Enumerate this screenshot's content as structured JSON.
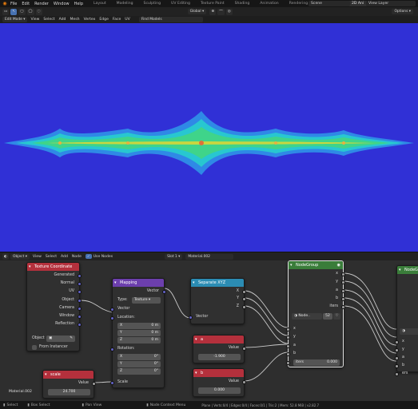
{
  "topbar": {
    "menu": [
      "File",
      "Edit",
      "Render",
      "Window",
      "Help"
    ],
    "workspaces": [
      "Layout",
      "Modeling",
      "Sculpting",
      "UV Editing",
      "Texture Paint",
      "Shading",
      "Animation",
      "Rendering",
      "Compositing",
      "2D Ani"
    ],
    "active_workspace": "2D Ani",
    "scene": "Scene",
    "view_layer": "View Layer"
  },
  "header": {
    "mode": "Edit Mode",
    "menu": [
      "View",
      "Select",
      "Add",
      "Mesh",
      "Vertex",
      "Edge",
      "Face",
      "UV"
    ],
    "transform": "Global",
    "options": "Options",
    "find": "Find Models"
  },
  "node_editor": {
    "type": "Object",
    "menu": [
      "View",
      "Select",
      "Add",
      "Node"
    ],
    "use_nodes_label": "Use Nodes",
    "slot": "Slot 1",
    "material": "Material.002",
    "material_name_bottom": "Material.002"
  },
  "nodes": {
    "texcoord": {
      "title": "Texture Coordinate",
      "outputs": [
        "Generated",
        "Normal",
        "UV",
        "Object",
        "Camera",
        "Window",
        "Reflection"
      ],
      "object_label": "Object",
      "from_instancer": "From Instancer",
      "color": "#b4303c"
    },
    "mapping": {
      "title": "Mapping",
      "output": "Vector",
      "type_label": "Type:",
      "type_value": "Texture",
      "vector_in": "Vector",
      "location_label": "Location:",
      "location": [
        {
          "axis": "X",
          "value": "0 m"
        },
        {
          "axis": "Y",
          "value": "0 m"
        },
        {
          "axis": "Z",
          "value": "0 m"
        }
      ],
      "rotation_label": "Rotation:",
      "rotation": [
        {
          "axis": "X",
          "value": "0°"
        },
        {
          "axis": "Y",
          "value": "0°"
        },
        {
          "axis": "Z",
          "value": "0°"
        }
      ],
      "scale_label": "Scale",
      "color": "#6c3fad"
    },
    "separate": {
      "title": "Separate XYZ",
      "outputs": [
        "X",
        "Y",
        "Z"
      ],
      "input": "Vector",
      "color": "#2b8cb3"
    },
    "a": {
      "title": "a",
      "output": "Value",
      "value": "-1.900",
      "color": "#b4303c"
    },
    "b": {
      "title": "b",
      "output": "Value",
      "value": "0.000",
      "color": "#b4303c"
    },
    "scale": {
      "title": "scale",
      "output": "Value",
      "value": "24.700",
      "color": "#b4303c"
    },
    "group": {
      "title": "NodeGroup",
      "outputs": [
        "x",
        "y",
        "a",
        "b",
        "iters"
      ],
      "group_name": "Node..",
      "users": "52",
      "inputs": [
        "x",
        "y",
        "a",
        "b"
      ],
      "iters_label": "iters",
      "iters_value": "0.000",
      "color": "#3a7d3a"
    },
    "group2": {
      "title": "NodeG",
      "inputs": [
        "x",
        "y",
        "a",
        "b"
      ],
      "iters_label": "ers",
      "color": "#3a7d3a"
    }
  },
  "status": {
    "select": "Select",
    "box_select": "Box Select",
    "pan": "Pan View",
    "context": "Node Context Menu",
    "stats": "Plane | Verts:0/4 | Edges:0/4 | Faces:0/1 | Tris:2 | Mem: 52.8 MiB | v2.82.7"
  },
  "colors": {
    "viewport_bg": "#3030d6",
    "fractal_outer": "#2f89e6",
    "fractal_mid": "#28c7d0",
    "fractal_inner": "#3fd48a",
    "fractal_core": "#c9d640"
  }
}
